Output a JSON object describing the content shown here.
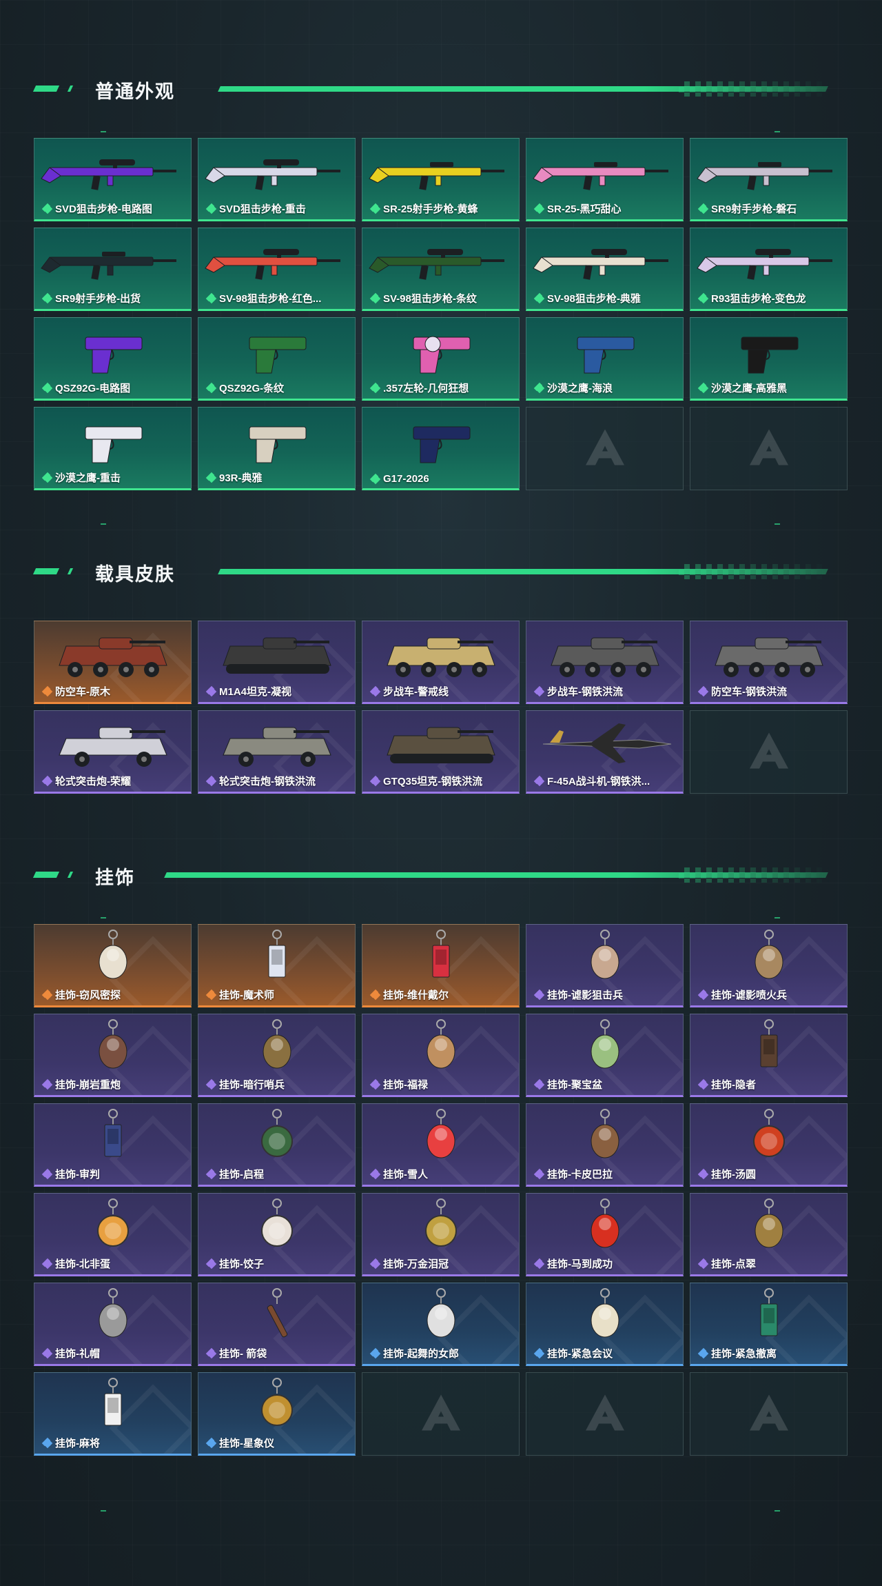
{
  "colors": {
    "accent": "#2fd987",
    "green_tier": "#3fe58f",
    "purple_tier": "#9a79e8",
    "orange_tier": "#ee8a3c",
    "blue_tier": "#5aa6ee"
  },
  "sections": [
    {
      "title": "普通外观",
      "items": [
        {
          "label": "SVD狙击步枪-电路图",
          "tier": "green",
          "icon": "sniper-rifle",
          "color": "#6a2fd0"
        },
        {
          "label": "SVD狙击步枪-重击",
          "tier": "green",
          "icon": "sniper-rifle",
          "color": "#d8d8e8"
        },
        {
          "label": "SR-25射手步枪-黄蜂",
          "tier": "green",
          "icon": "rifle",
          "color": "#e8d020"
        },
        {
          "label": "SR-25-黑巧甜心",
          "tier": "green",
          "icon": "rifle",
          "color": "#e88ac0"
        },
        {
          "label": "SR9射手步枪-磐石",
          "tier": "green",
          "icon": "rifle",
          "color": "#c8c0d0"
        },
        {
          "label": "SR9射手步枪-出货",
          "tier": "green",
          "icon": "rifle",
          "color": "#1e2a30"
        },
        {
          "label": "SV-98狙击步枪-红色...",
          "tier": "green",
          "icon": "sniper-rifle",
          "color": "#e05040"
        },
        {
          "label": "SV-98狙击步枪-条纹",
          "tier": "green",
          "icon": "sniper-rifle",
          "color": "#2a5a2a"
        },
        {
          "label": "SV-98狙击步枪-典雅",
          "tier": "green",
          "icon": "sniper-rifle",
          "color": "#e8e0d0"
        },
        {
          "label": "R93狙击步枪-变色龙",
          "tier": "green",
          "icon": "sniper-rifle",
          "color": "#d8c8e8"
        },
        {
          "label": "QSZ92G-电路图",
          "tier": "green",
          "icon": "pistol",
          "color": "#6a2fd0"
        },
        {
          "label": "QSZ92G-条纹",
          "tier": "green",
          "icon": "pistol",
          "color": "#2a7a3a"
        },
        {
          "label": ".357左轮-几何狂想",
          "tier": "green",
          "icon": "revolver",
          "color": "#e060b0"
        },
        {
          "label": "沙漠之鹰-海浪",
          "tier": "green",
          "icon": "pistol",
          "color": "#2a5aa0"
        },
        {
          "label": "沙漠之鹰-高雅黑",
          "tier": "green",
          "icon": "pistol",
          "color": "#1a1a1a"
        },
        {
          "label": "沙漠之鹰-重击",
          "tier": "green",
          "icon": "pistol",
          "color": "#e8e8f0"
        },
        {
          "label": "93R-典雅",
          "tier": "green",
          "icon": "pistol",
          "color": "#d8d0c0"
        },
        {
          "label": "G17-2026",
          "tier": "green",
          "icon": "pistol",
          "color": "#1e2a60"
        },
        {
          "label": "",
          "tier": "empty",
          "icon": "empty-slot",
          "color": ""
        },
        {
          "label": "",
          "tier": "empty",
          "icon": "empty-slot",
          "color": ""
        }
      ]
    },
    {
      "title": "载具皮肤",
      "items": [
        {
          "label": "防空车-原木",
          "tier": "orange",
          "icon": "armored-vehicle",
          "color": "#8a3a2a"
        },
        {
          "label": "M1A4坦克-凝视",
          "tier": "purple",
          "icon": "tank",
          "color": "#3a3a3a"
        },
        {
          "label": "步战车-警戒线",
          "tier": "purple",
          "icon": "armored-vehicle",
          "color": "#c8b070"
        },
        {
          "label": "步战车-钢铁洪流",
          "tier": "purple",
          "icon": "armored-vehicle",
          "color": "#5a5a5a"
        },
        {
          "label": "防空车-钢铁洪流",
          "tier": "purple",
          "icon": "armored-vehicle",
          "color": "#6a6a6a"
        },
        {
          "label": "轮式突击炮-荣耀",
          "tier": "purple",
          "icon": "buggy",
          "color": "#d0d0d8"
        },
        {
          "label": "轮式突击炮-钢铁洪流",
          "tier": "purple",
          "icon": "buggy",
          "color": "#8a8a80"
        },
        {
          "label": "GTQ35坦克-钢铁洪流",
          "tier": "purple",
          "icon": "tank",
          "color": "#5a5040"
        },
        {
          "label": "F-45A战斗机-钢铁洪...",
          "tier": "purple",
          "icon": "jet",
          "color": "#2a2a2a"
        },
        {
          "label": "",
          "tier": "empty",
          "icon": "empty-slot",
          "color": ""
        }
      ]
    },
    {
      "title": "挂饰",
      "items": [
        {
          "label": "挂饰-窃风密探",
          "tier": "orange",
          "icon": "charm",
          "color": "#e8e0d0"
        },
        {
          "label": "挂饰-魔术师",
          "tier": "orange",
          "icon": "charm-card",
          "color": "#dfe4f0"
        },
        {
          "label": "挂饰-维什戴尔",
          "tier": "orange",
          "icon": "charm-card",
          "color": "#d83040"
        },
        {
          "label": "挂饰-谑影狙击兵",
          "tier": "purple",
          "icon": "charm",
          "color": "#c8a890"
        },
        {
          "label": "挂饰-谑影喷火兵",
          "tier": "purple",
          "icon": "charm",
          "color": "#a88860"
        },
        {
          "label": "挂饰-崩岩重炮",
          "tier": "purple",
          "icon": "charm",
          "color": "#7a5040"
        },
        {
          "label": "挂饰-暗行哨兵",
          "tier": "purple",
          "icon": "charm",
          "color": "#8a7040"
        },
        {
          "label": "挂饰-福禄",
          "tier": "purple",
          "icon": "charm",
          "color": "#c09060"
        },
        {
          "label": "挂饰-聚宝盆",
          "tier": "purple",
          "icon": "charm",
          "color": "#9ac080"
        },
        {
          "label": "挂饰-隐者",
          "tier": "purple",
          "icon": "charm-card",
          "color": "#5a4030"
        },
        {
          "label": "挂饰-审判",
          "tier": "purple",
          "icon": "charm-card",
          "color": "#3a4a8a"
        },
        {
          "label": "挂饰-启程",
          "tier": "purple",
          "icon": "charm-round",
          "color": "#3a6a40"
        },
        {
          "label": "挂饰-雪人",
          "tier": "purple",
          "icon": "charm",
          "color": "#e84040"
        },
        {
          "label": "挂饰-卡皮巴拉",
          "tier": "purple",
          "icon": "charm",
          "color": "#8a6040"
        },
        {
          "label": "挂饰-汤圆",
          "tier": "purple",
          "icon": "charm-round",
          "color": "#d04020"
        },
        {
          "label": "挂饰-北非蛋",
          "tier": "purple",
          "icon": "charm-round",
          "color": "#e8a040"
        },
        {
          "label": "挂饰-饺子",
          "tier": "purple",
          "icon": "charm-round",
          "color": "#e8e0d8"
        },
        {
          "label": "挂饰-万金泪冠",
          "tier": "purple",
          "icon": "charm-round",
          "color": "#c0a040"
        },
        {
          "label": "挂饰-马到成功",
          "tier": "purple",
          "icon": "charm",
          "color": "#d83020"
        },
        {
          "label": "挂饰-点翠",
          "tier": "purple",
          "icon": "charm",
          "color": "#a08040"
        },
        {
          "label": "挂饰-礼帽",
          "tier": "purple",
          "icon": "charm",
          "color": "#9a9a9a"
        },
        {
          "label": "挂饰- 箭袋",
          "tier": "purple",
          "icon": "charm-stick",
          "color": "#7a4a30"
        },
        {
          "label": "挂饰-起舞的女郎",
          "tier": "blue",
          "icon": "charm",
          "color": "#e0e0e0"
        },
        {
          "label": "挂饰-紧急会议",
          "tier": "blue",
          "icon": "charm",
          "color": "#e8e0c8"
        },
        {
          "label": "挂饰-紧急撤离",
          "tier": "blue",
          "icon": "charm-card",
          "color": "#2a8a6a"
        },
        {
          "label": "挂饰-麻将",
          "tier": "blue",
          "icon": "charm-card",
          "color": "#f0f0f0"
        },
        {
          "label": "挂饰-星象仪",
          "tier": "blue",
          "icon": "charm-round",
          "color": "#c09030"
        },
        {
          "label": "",
          "tier": "empty",
          "icon": "empty-slot",
          "color": ""
        },
        {
          "label": "",
          "tier": "empty",
          "icon": "empty-slot",
          "color": ""
        },
        {
          "label": "",
          "tier": "empty",
          "icon": "empty-slot",
          "color": ""
        }
      ]
    }
  ]
}
